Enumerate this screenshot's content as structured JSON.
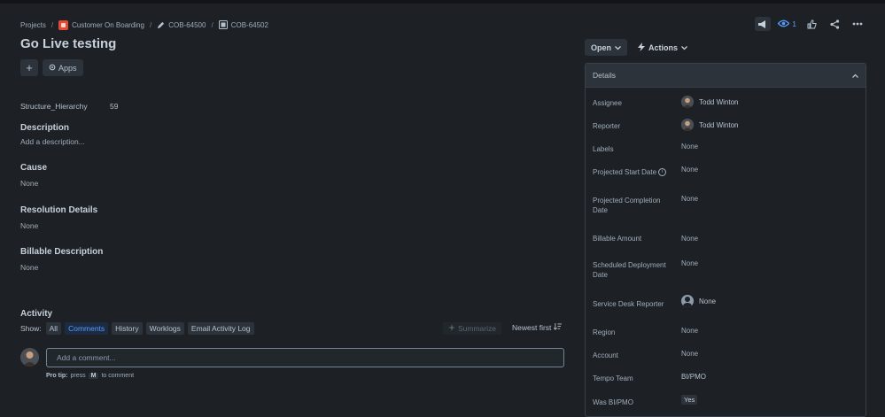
{
  "breadcrumb": {
    "projects": "Projects",
    "project": "Customer On Boarding",
    "parent": "COB-64500",
    "issue": "COB-64502",
    "separator": "/"
  },
  "issue": {
    "title": "Go Live testing",
    "add_button": "+",
    "apps_label": "Apps"
  },
  "fields": {
    "structure_label": "Structure_Hierarchy",
    "structure_value": "59",
    "description_label": "Description",
    "description_placeholder": "Add a description...",
    "cause_label": "Cause",
    "cause_value": "None",
    "resolution_label": "Resolution Details",
    "resolution_value": "None",
    "billable_label": "Billable Description",
    "billable_value": "None"
  },
  "activity": {
    "heading": "Activity",
    "show_label": "Show:",
    "filters": [
      "All",
      "Comments",
      "History",
      "Worklogs",
      "Email Activity Log"
    ],
    "active_filter": "Comments",
    "summarize": "Summarize",
    "sort": "Newest first",
    "comment_placeholder": "Add a comment...",
    "protip_prefix": "Pro tip:",
    "protip_press": "press",
    "protip_key": "M",
    "protip_suffix": "to comment"
  },
  "header_actions": {
    "watch_count": "1",
    "status": "Open",
    "actions": "Actions"
  },
  "details": {
    "heading": "Details",
    "rows": [
      {
        "label": "Assignee",
        "value": "Todd Winton"
      },
      {
        "label": "Reporter",
        "value": "Todd Winton"
      },
      {
        "label": "Labels",
        "value": "None"
      },
      {
        "label": "Projected Start Date",
        "value": "None"
      },
      {
        "label": "Projected Completion Date",
        "value": "None"
      },
      {
        "label": "Billable Amount",
        "value": "None"
      },
      {
        "label": "Scheduled Deployment Date",
        "value": "None"
      },
      {
        "label": "Service Desk Reporter",
        "value": "None"
      },
      {
        "label": "Region",
        "value": "None"
      },
      {
        "label": "Account",
        "value": "None"
      },
      {
        "label": "Tempo Team",
        "value": "BI/PMO"
      },
      {
        "label": "Was BI/PMO",
        "value": "Yes"
      }
    ]
  },
  "colors": {
    "background": "#1d2125",
    "accent": "#579dff",
    "text": "#b6c2cf"
  }
}
